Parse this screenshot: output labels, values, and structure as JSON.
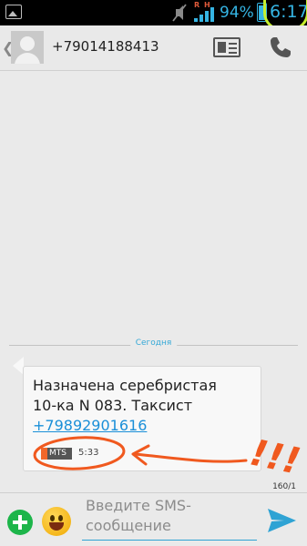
{
  "status_bar": {
    "roaming_indicator": "R H",
    "battery_percent": "94%",
    "time": "6:17",
    "icons": [
      "image-notification-icon",
      "mute-icon",
      "signal-icon",
      "battery-icon"
    ]
  },
  "header": {
    "back_icon": "chevron-left-icon",
    "contact_number": "+79014188413",
    "icons": [
      "avatar",
      "contact-card-icon",
      "phone-icon"
    ]
  },
  "conversation": {
    "date_label": "Сегодня",
    "messages": [
      {
        "text_line1": "Назначена серебристая",
        "text_line2": "10-ка N 083. Таксист",
        "link": "+79892901616",
        "sim_label": "MTS",
        "time": "5:33"
      }
    ]
  },
  "annotation": {
    "exclamation": "!!!",
    "color": "#f0591f"
  },
  "composer": {
    "char_counter": "160/1",
    "input_placeholder": "Введите SMS-сообщение",
    "icons": [
      "add-icon",
      "smiley-icon",
      "send-icon"
    ]
  },
  "colors": {
    "accent_blue": "#35b4e3",
    "link_blue": "#1a8fd8",
    "highlight_green": "#c6ef2e",
    "send_blue": "#2fa3d4",
    "add_green": "#1db54a"
  }
}
